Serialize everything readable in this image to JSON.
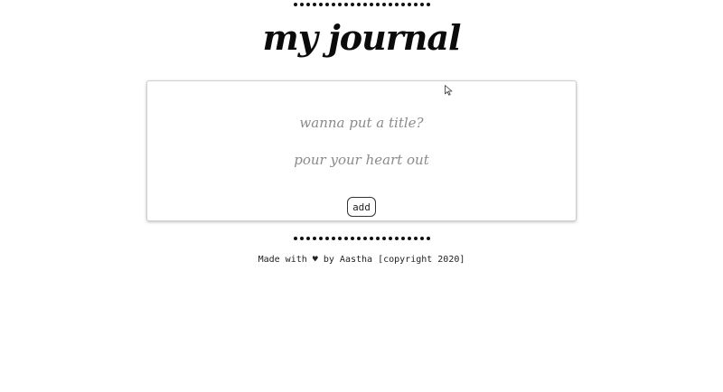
{
  "header": {
    "title": "my journal"
  },
  "dots": {
    "count": 22
  },
  "composer": {
    "title_placeholder": "wanna put a title?",
    "body_placeholder": "pour your heart out",
    "add_label": "add"
  },
  "footer": {
    "made_with": "Made with",
    "heart": "♥",
    "by_text": "by Aastha [copyright 2020]"
  },
  "icons": {
    "cursor": "mouse-pointer-icon",
    "heart": "heart-icon"
  }
}
